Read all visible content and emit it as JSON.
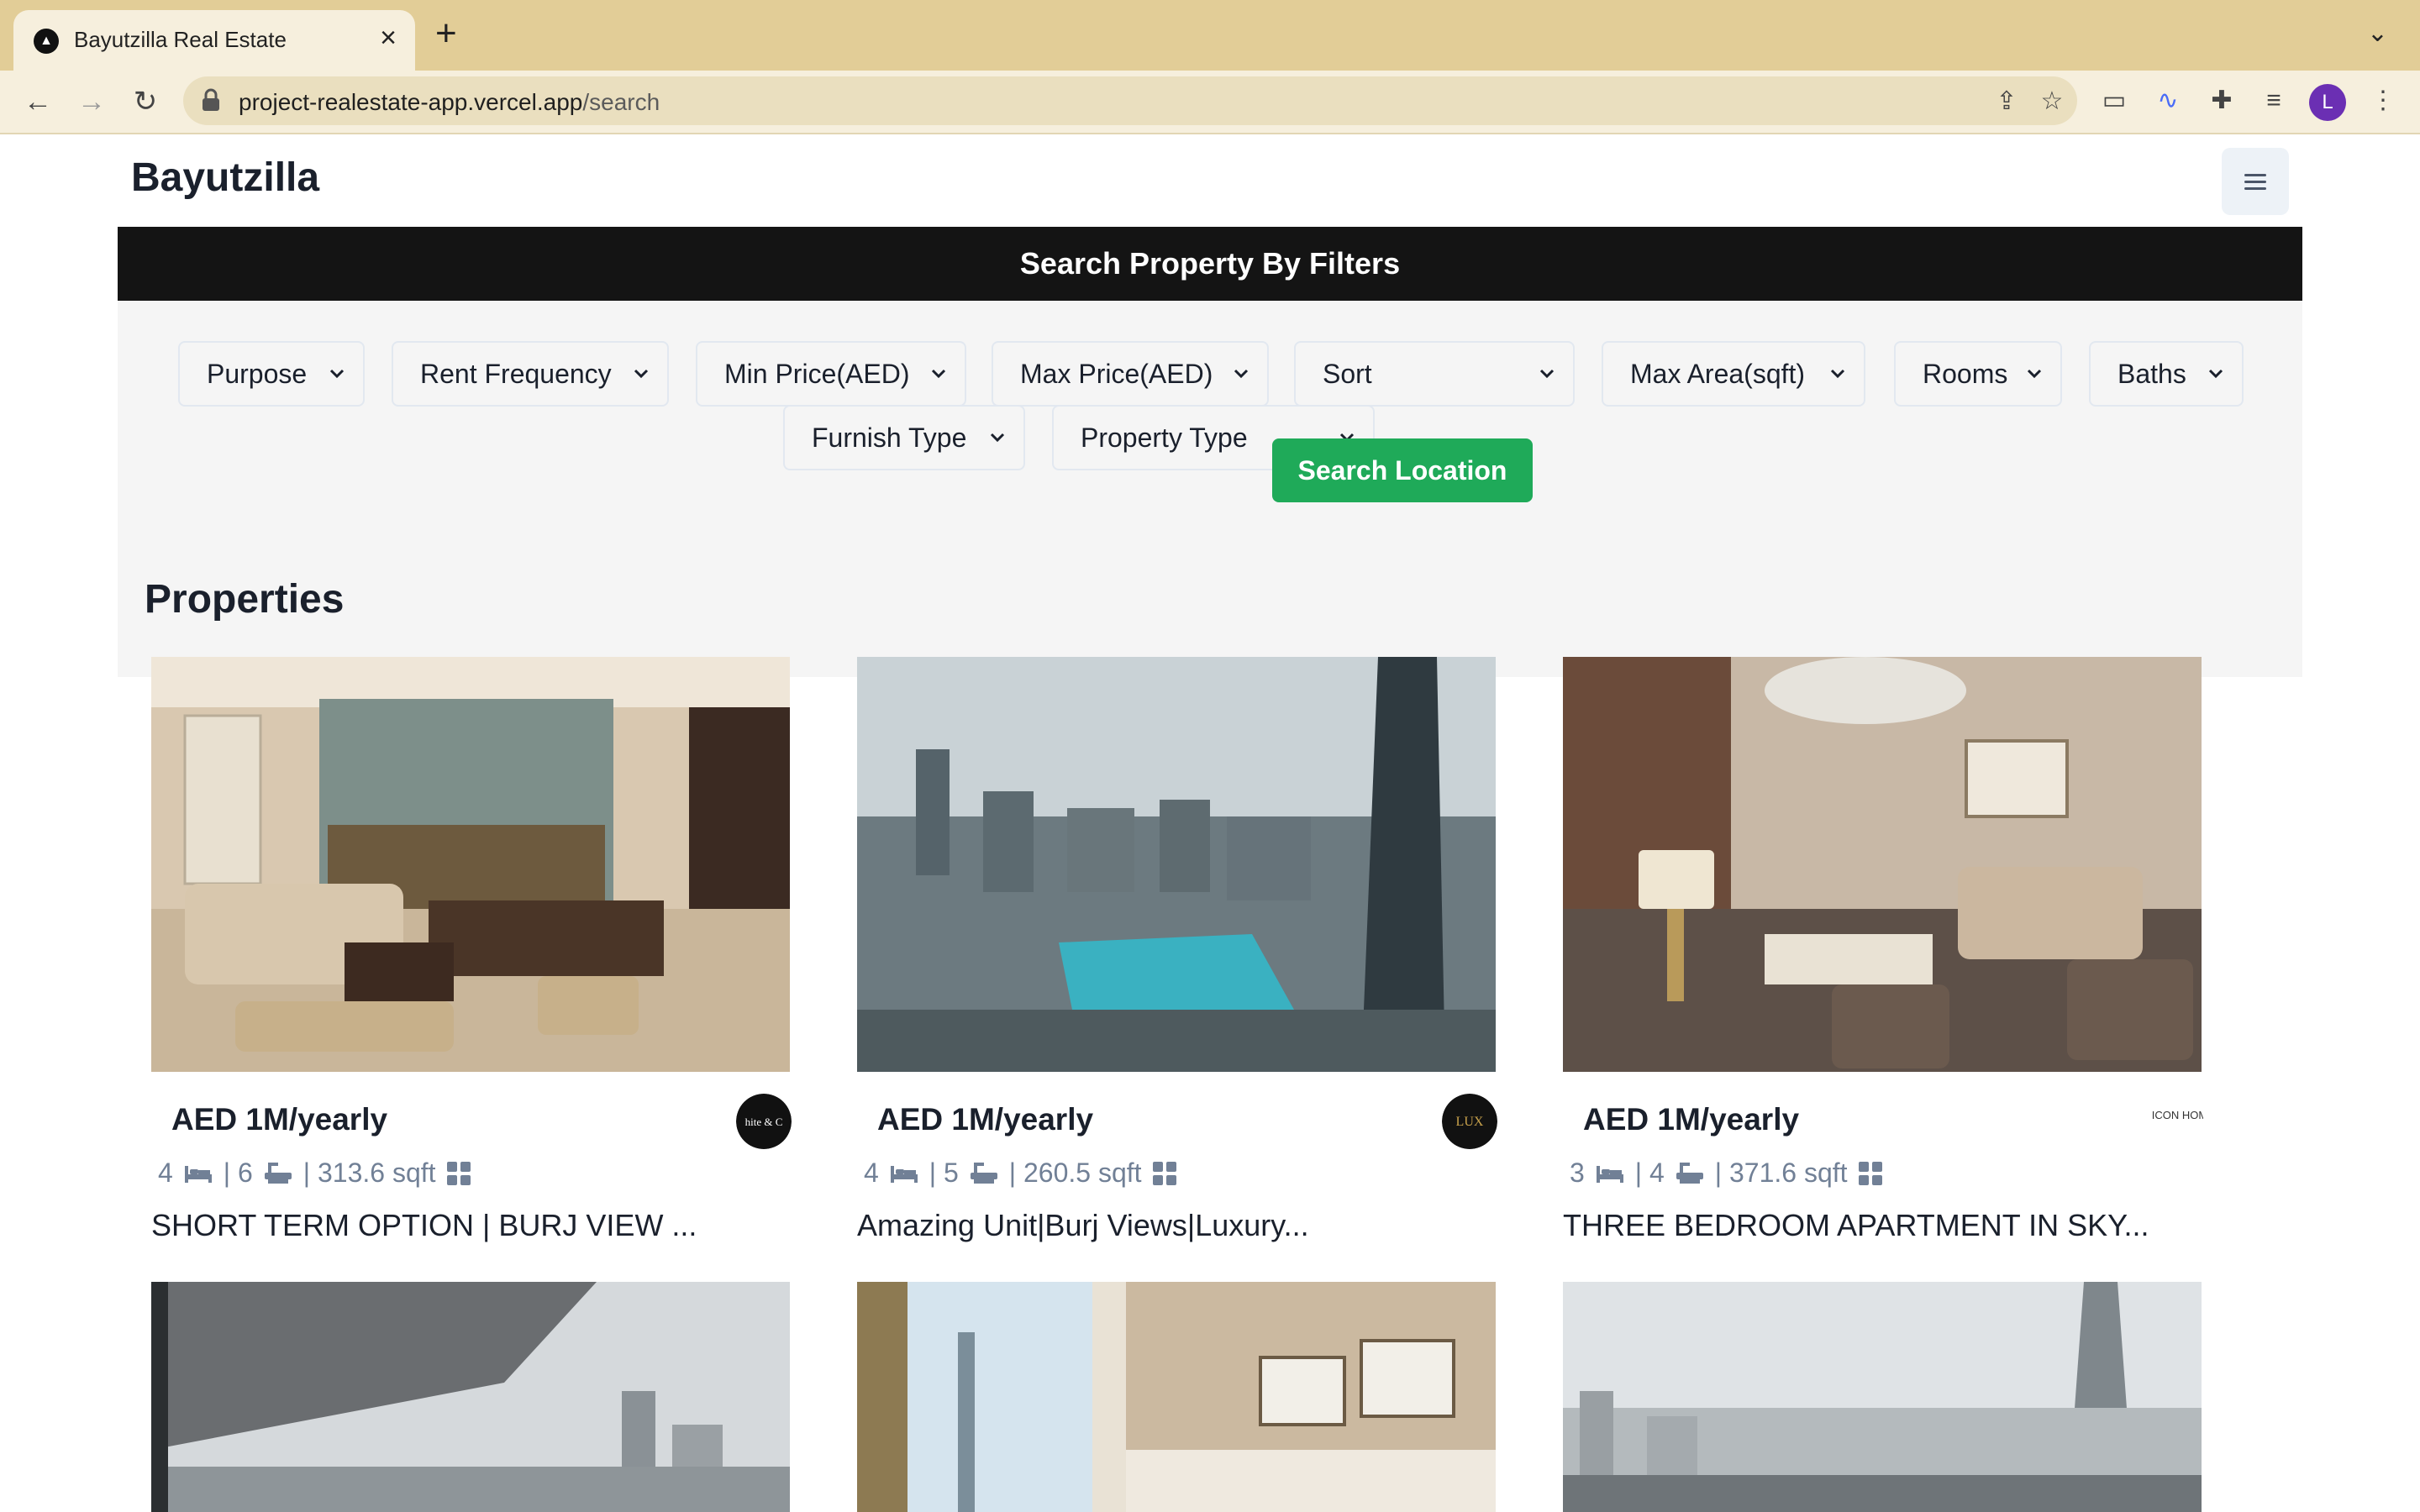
{
  "browser": {
    "tab_title": "Bayutzilla Real Estate",
    "url_host": "project-realestate-app.vercel.app",
    "url_path": "/search",
    "profile_initial": "L"
  },
  "navbar": {
    "brand": "Bayutzilla"
  },
  "filters": {
    "header": "Search Property By Filters",
    "selects": [
      {
        "label": "Purpose"
      },
      {
        "label": "Rent Frequency"
      },
      {
        "label": "Min Price(AED)"
      },
      {
        "label": "Max Price(AED)"
      },
      {
        "label": "Sort"
      },
      {
        "label": "Max Area(sqft)"
      },
      {
        "label": "Rooms"
      },
      {
        "label": "Baths"
      },
      {
        "label": "Furnish Type"
      },
      {
        "label": "Property Type"
      }
    ],
    "search_location_label": "Search Location"
  },
  "properties": {
    "title": "Properties",
    "items": [
      {
        "price": "AED 1M/yearly",
        "rooms": "4",
        "baths": "| 6",
        "area": "| 313.6 sqft",
        "title": "SHORT TERM OPTION | BURJ VIEW ...",
        "logo_text": "hite & C"
      },
      {
        "price": "AED 1M/yearly",
        "rooms": "4",
        "baths": "| 5",
        "area": "| 260.5 sqft",
        "title": "Amazing Unit|Burj Views|Luxury...",
        "logo_text": "LUX"
      },
      {
        "price": "AED 1M/yearly",
        "rooms": "3",
        "baths": "| 4",
        "area": "| 371.6 sqft",
        "title": "THREE BEDROOM APARTMENT IN SKY...",
        "logo_text": "ICON HOM"
      },
      {
        "price": "",
        "rooms": "",
        "baths": "",
        "area": "",
        "title": ""
      },
      {
        "price": "",
        "rooms": "",
        "baths": "",
        "area": "",
        "title": ""
      },
      {
        "price": "",
        "rooms": "",
        "baths": "",
        "area": "",
        "title": ""
      }
    ]
  },
  "colors": {
    "tabbar": "#e2cd97",
    "header_bar": "#141414",
    "search_button": "#1faa59",
    "meta_text": "#718096"
  }
}
